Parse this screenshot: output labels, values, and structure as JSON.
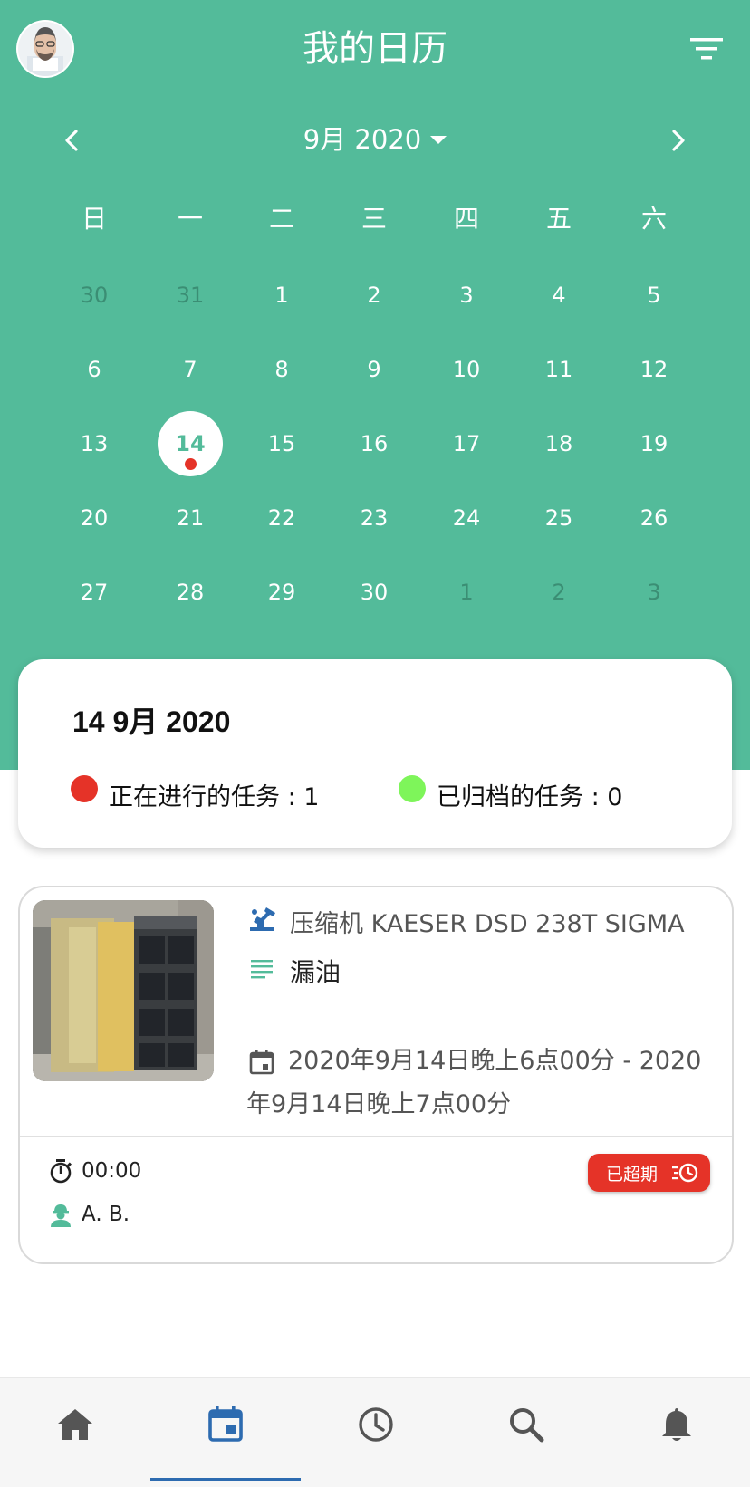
{
  "header": {
    "title": "我的日历",
    "month_label": "9月 2020"
  },
  "weekdays": [
    "日",
    "一",
    "二",
    "三",
    "四",
    "五",
    "六"
  ],
  "weeks": [
    [
      "30",
      "31",
      "1",
      "2",
      "3",
      "4",
      "5"
    ],
    [
      "6",
      "7",
      "8",
      "9",
      "10",
      "11",
      "12"
    ],
    [
      "13",
      "14",
      "15",
      "16",
      "17",
      "18",
      "19"
    ],
    [
      "20",
      "21",
      "22",
      "23",
      "24",
      "25",
      "26"
    ],
    [
      "27",
      "28",
      "29",
      "30",
      "1",
      "2",
      "3"
    ]
  ],
  "summary": {
    "date": "14 9月 2020",
    "in_progress": "正在进行的任务 : 1",
    "archived": "已归档的任务 : 0"
  },
  "task": {
    "equipment": "压缩机 KAESER DSD 238T SIGMA",
    "description": "漏油",
    "time_range": "2020年9月14日晚上6点00分 - 2020年9月14日晚上7点00分",
    "timer": "00:00",
    "technician": "A. B.",
    "status": "已超期"
  },
  "colors": {
    "primary": "#53bb9a",
    "danger": "#e53328",
    "archived": "#7ef55a",
    "active_nav": "#2d6bb0"
  },
  "nav": [
    "home-icon",
    "calendar-icon",
    "clock-icon",
    "search-icon",
    "bell-icon"
  ]
}
